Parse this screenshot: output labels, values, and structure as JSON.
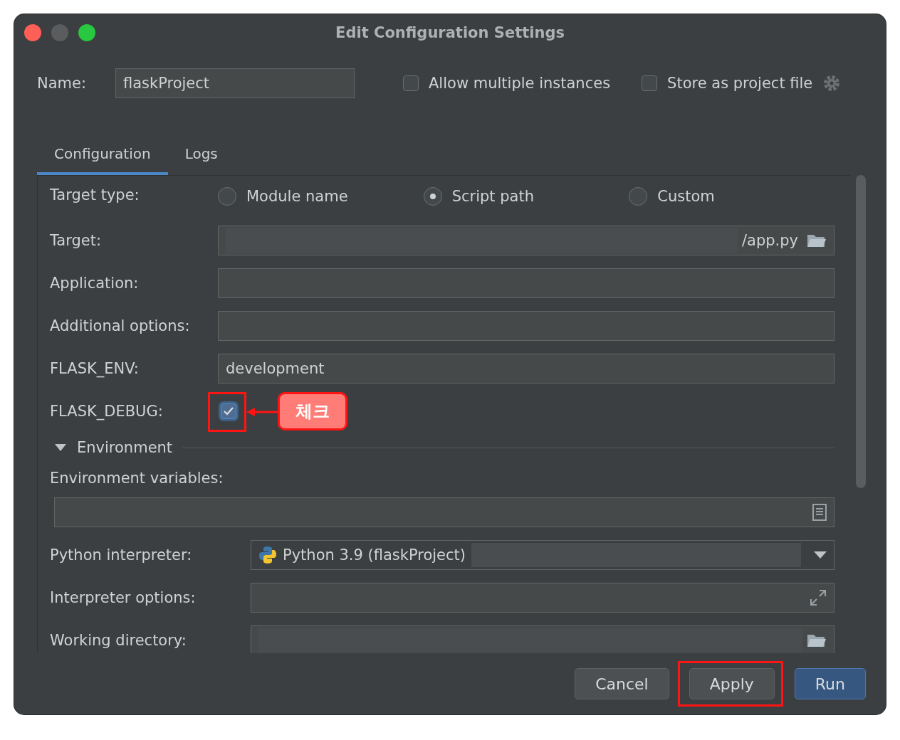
{
  "window": {
    "title": "Edit Configuration Settings"
  },
  "name_field": {
    "label": "Name:",
    "value": "flaskProject"
  },
  "options": [
    {
      "label": "Allow multiple instances",
      "checked": false
    },
    {
      "label": "Store as project file",
      "checked": false
    }
  ],
  "tabs": [
    {
      "label": "Configuration",
      "selected": true
    },
    {
      "label": "Logs",
      "selected": false
    }
  ],
  "target_type": {
    "label": "Target type:",
    "options": [
      {
        "label": "Module name",
        "selected": false
      },
      {
        "label": "Script path",
        "selected": true
      },
      {
        "label": "Custom",
        "selected": false
      }
    ]
  },
  "rows": [
    {
      "kind": "path",
      "label": "Target:",
      "value": "/app.py"
    },
    {
      "kind": "text",
      "label": "Application:"
    },
    {
      "kind": "text",
      "label": "Additional options:"
    },
    {
      "kind": "text",
      "label": "FLASK_ENV:",
      "value": "development"
    },
    {
      "kind": "checkbox",
      "label": "FLASK_DEBUG:",
      "checked": true,
      "callout": "체크"
    },
    {
      "kind": "section",
      "label": "Environment",
      "expanded": true
    },
    {
      "kind": "env",
      "label": "Environment variables:"
    },
    {
      "kind": "dropdown",
      "label": "Python interpreter:",
      "value": "Python 3.9 (flaskProject)"
    },
    {
      "kind": "expand",
      "label": "Interpreter options:"
    },
    {
      "kind": "dir",
      "label": "Working directory:"
    }
  ],
  "buttons": [
    {
      "label": "Cancel",
      "kind": "default",
      "highlighted": false
    },
    {
      "label": "Apply",
      "kind": "default",
      "highlighted": true
    },
    {
      "label": "Run",
      "kind": "primary",
      "highlighted": false
    }
  ]
}
